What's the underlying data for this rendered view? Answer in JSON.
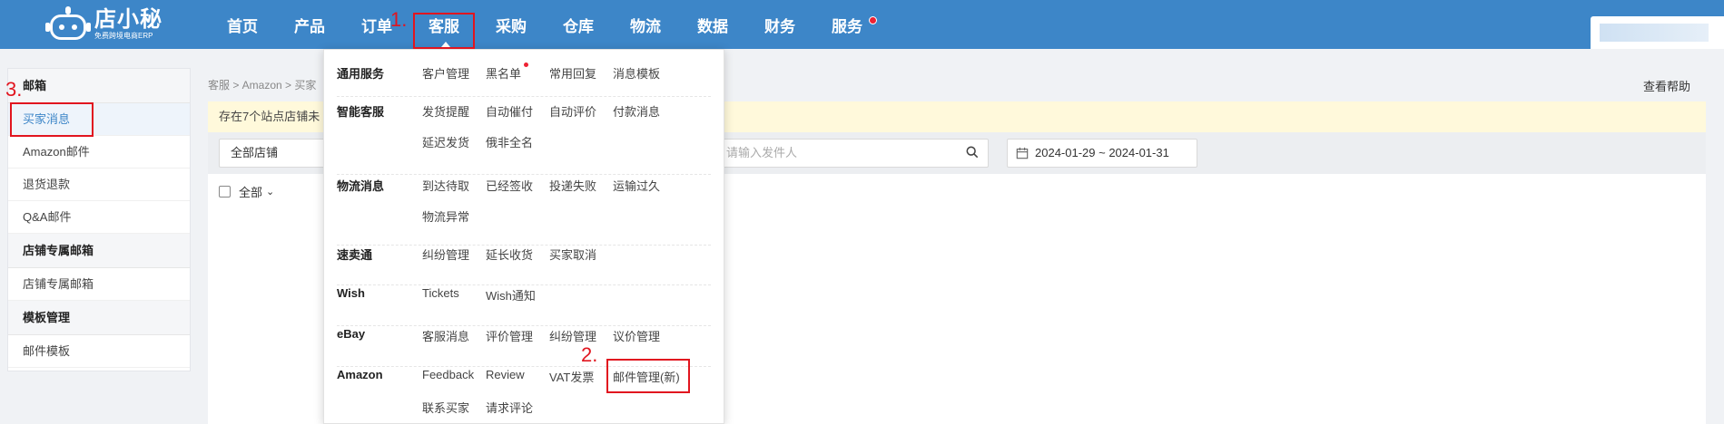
{
  "app": {
    "logo_name": "店小秘",
    "logo_sub": "免费跨境电商ERP"
  },
  "nav": [
    "首页",
    "产品",
    "订单",
    "客服",
    "采购",
    "仓库",
    "物流",
    "数据",
    "财务",
    "服务"
  ],
  "sidebar": {
    "groups": [
      {
        "title": "邮箱",
        "items": [
          "买家消息",
          "Amazon邮件",
          "退货退款",
          "Q&A邮件"
        ]
      },
      {
        "title": "店铺专属邮箱",
        "items": [
          "店铺专属邮箱"
        ]
      },
      {
        "title": "模板管理",
        "items": [
          "邮件模板"
        ]
      }
    ]
  },
  "main": {
    "breadcrumb": "客服 > Amazon > 买家",
    "help": "查看帮助",
    "notice": "存在7个站点店铺未",
    "store_select": "全部店铺",
    "search_placeholder": "请输入发件人",
    "date_range": "2024-01-29 ~ 2024-01-31",
    "select_all": "全部"
  },
  "dropdown": {
    "sections": [
      {
        "title": "通用服务",
        "links": [
          "客户管理",
          "黑名单",
          "常用回复",
          "消息模板"
        ]
      },
      {
        "title": "智能客服",
        "links": [
          "发货提醒",
          "自动催付",
          "自动评价",
          "付款消息",
          "延迟发货",
          "俄非全名"
        ]
      },
      {
        "title": "物流消息",
        "links": [
          "到达待取",
          "已经签收",
          "投递失败",
          "运输过久",
          "物流异常"
        ]
      },
      {
        "title": "速卖通",
        "links": [
          "纠纷管理",
          "延长收货",
          "买家取消"
        ]
      },
      {
        "title": "Wish",
        "links": [
          "Tickets",
          "Wish通知"
        ]
      },
      {
        "title": "eBay",
        "links": [
          "客服消息",
          "评价管理",
          "纠纷管理",
          "议价管理"
        ]
      },
      {
        "title": "Amazon",
        "links": [
          "Feedback",
          "Review",
          "VAT发票",
          "邮件管理(新)",
          "联系买家",
          "请求评论"
        ]
      }
    ]
  },
  "annotations": {
    "step1": "1.",
    "step2": "2.",
    "step3": "3."
  },
  "colors": {
    "topbar": "#3d86c8",
    "annotation": "#e1151f",
    "notice_bg": "#fff9db"
  }
}
